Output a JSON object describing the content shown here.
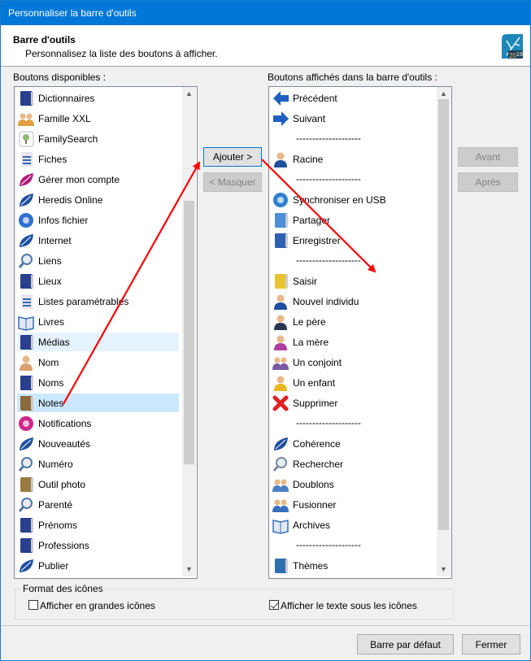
{
  "window": {
    "title": "Personnaliser la barre d'outils"
  },
  "header": {
    "title": "Barre d'outils",
    "subtitle": "Personnalisez la liste des boutons à afficher.",
    "logo_text": "2019"
  },
  "available": {
    "label": "Boutons disponibles :",
    "scroll_position": 0.37,
    "items": [
      {
        "label": "Dictionnaires",
        "icon": "dictionary-book-icon"
      },
      {
        "label": "Famille XXL",
        "icon": "family-group-icon"
      },
      {
        "label": "FamilySearch",
        "icon": "familysearch-tree-icon"
      },
      {
        "label": "Fiches",
        "icon": "record-sheet-icon"
      },
      {
        "label": "Gérer mon compte",
        "icon": "account-leaf-icon"
      },
      {
        "label": "Heredis Online",
        "icon": "heredis-online-leaf-icon"
      },
      {
        "label": "Infos fichier",
        "icon": "info-icon"
      },
      {
        "label": "Internet",
        "icon": "internet-leaf-icon"
      },
      {
        "label": "Liens",
        "icon": "links-magnifier-icon"
      },
      {
        "label": "Lieux",
        "icon": "places-signpost-icon"
      },
      {
        "label": "Listes paramétrables",
        "icon": "configurable-list-icon"
      },
      {
        "label": "Livres",
        "icon": "open-book-icon"
      },
      {
        "label": "Médias",
        "icon": "media-film-icon"
      },
      {
        "label": "Nom",
        "icon": "person-name-icon"
      },
      {
        "label": "Noms",
        "icon": "names-letter-a-icon"
      },
      {
        "label": "Notes",
        "icon": "notes-clipboard-icon"
      },
      {
        "label": "Notifications",
        "icon": "notification-star-icon"
      },
      {
        "label": "Nouveautés",
        "icon": "news-leaf-icon"
      },
      {
        "label": "Numéro",
        "icon": "number-magnifier-icon"
      },
      {
        "label": "Outil photo",
        "icon": "photo-tool-icon"
      },
      {
        "label": "Parenté",
        "icon": "kinship-magnifier-icon"
      },
      {
        "label": "Prénoms",
        "icon": "first-names-book-icon"
      },
      {
        "label": "Professions",
        "icon": "professions-tie-icon"
      },
      {
        "label": "Publier",
        "icon": "publish-leaf-icon"
      }
    ],
    "selected": "Notes",
    "hovered": "Médias"
  },
  "middle_buttons": {
    "add": "Ajouter >",
    "hide": "< Masquer"
  },
  "displayed": {
    "label": "Boutons affichés dans la barre d'outils :",
    "scroll_position": 0.0,
    "items": [
      {
        "label": "Précédent",
        "icon": "back-arrow-icon"
      },
      {
        "label": "Suivant",
        "icon": "forward-arrow-icon"
      },
      {
        "separator": "--------------------"
      },
      {
        "label": "Racine",
        "icon": "root-person-icon"
      },
      {
        "separator": "--------------------"
      },
      {
        "label": "Synchroniser en USB",
        "icon": "usb-sync-icon"
      },
      {
        "label": "Partager",
        "icon": "share-screens-icon"
      },
      {
        "label": "Enregistrer",
        "icon": "save-floppy-icon"
      },
      {
        "separator": "--------------------"
      },
      {
        "label": "Saisir",
        "icon": "edit-pencil-icon"
      },
      {
        "label": "Nouvel individu",
        "icon": "new-person-icon"
      },
      {
        "label": "Le père",
        "icon": "father-icon"
      },
      {
        "label": "La mère",
        "icon": "mother-icon"
      },
      {
        "label": "Un conjoint",
        "icon": "spouse-icon"
      },
      {
        "label": "Un enfant",
        "icon": "child-icon"
      },
      {
        "label": "Supprimer",
        "icon": "delete-x-icon"
      },
      {
        "separator": "--------------------"
      },
      {
        "label": "Cohérence",
        "icon": "consistency-check-icon"
      },
      {
        "label": "Rechercher",
        "icon": "search-magnifier-icon"
      },
      {
        "label": "Doublons",
        "icon": "duplicates-icon"
      },
      {
        "label": "Fusionner",
        "icon": "merge-persons-icon"
      },
      {
        "label": "Archives",
        "icon": "archives-globe-icon"
      },
      {
        "separator": "--------------------"
      },
      {
        "label": "Thèmes",
        "icon": "themes-monitor-icon"
      }
    ]
  },
  "order_buttons": {
    "up": "Avant",
    "down": "Après"
  },
  "icon_format": {
    "legend": "Format des icônes",
    "large_icons": {
      "label": "Afficher en grandes icônes",
      "checked": false
    },
    "show_text": {
      "label": "Afficher le texte sous les icônes",
      "checked": true
    }
  },
  "footer": {
    "default_bar": "Barre par défaut",
    "close": "Fermer"
  },
  "colors": {
    "title_bar": "#0078d7",
    "selection": "#cce8ff",
    "hover": "#e5f3ff",
    "annotation_arrow": "#ff0000"
  }
}
